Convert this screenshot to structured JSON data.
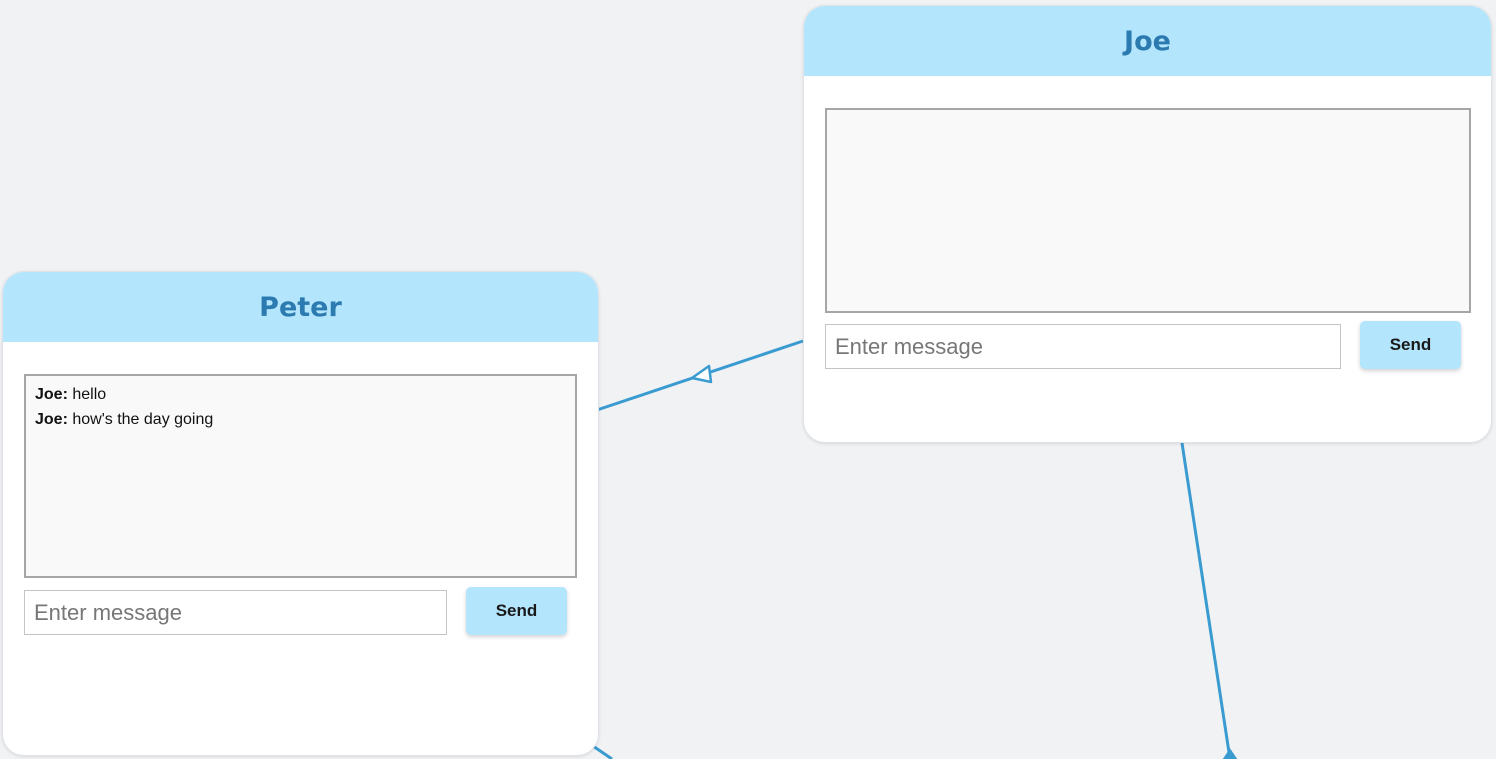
{
  "nodes": {
    "joe": {
      "title": "Joe",
      "messages": [],
      "input": {
        "value": "",
        "placeholder": "Enter message"
      },
      "send_label": "Send"
    },
    "peter": {
      "title": "Peter",
      "messages": [
        {
          "author": "Joe:",
          "text": "hello"
        },
        {
          "author": "Joe:",
          "text": "how's the day going"
        }
      ],
      "input": {
        "value": "",
        "placeholder": "Enter message"
      },
      "send_label": "Send"
    }
  },
  "colors": {
    "canvas_background": "#f1f2f4",
    "node_header": "#b3e5fc",
    "title_text": "#2b7ab0",
    "edge": "#3a9bd1",
    "button": "#b3e5fc"
  }
}
